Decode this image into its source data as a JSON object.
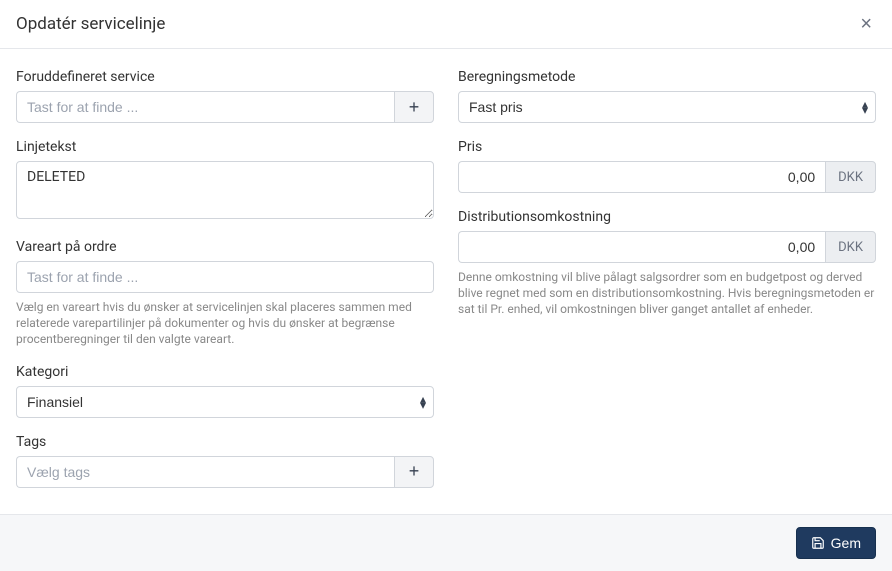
{
  "header": {
    "title": "Opdatér servicelinje"
  },
  "left": {
    "predefined": {
      "label": "Foruddefineret service",
      "placeholder": "Tast for at finde ..."
    },
    "linetext": {
      "label": "Linjetekst",
      "value": "DELETED"
    },
    "itemtype": {
      "label": "Vareart på ordre",
      "placeholder": "Tast for at finde ...",
      "help": "Vælg en vareart hvis du ønsker at servicelinjen skal placeres sammen med relaterede varepartilinjer på dokumenter og hvis du ønsker at begrænse procentberegninger til den valgte vareart."
    },
    "category": {
      "label": "Kategori",
      "value": "Finansiel"
    },
    "tags": {
      "label": "Tags",
      "placeholder": "Vælg tags"
    }
  },
  "right": {
    "method": {
      "label": "Beregningsmetode",
      "value": "Fast pris"
    },
    "price": {
      "label": "Pris",
      "value": "0,00",
      "currency": "DKK"
    },
    "distribution": {
      "label": "Distributionsomkostning",
      "value": "0,00",
      "currency": "DKK",
      "help": "Denne omkostning vil blive pålagt salgsordrer som en budgetpost og derved blive regnet med som en distributionsomkostning. Hvis beregningsmetoden er sat til Pr. enhed, vil omkostningen bliver ganget antallet af enheder."
    }
  },
  "footer": {
    "save": "Gem"
  }
}
